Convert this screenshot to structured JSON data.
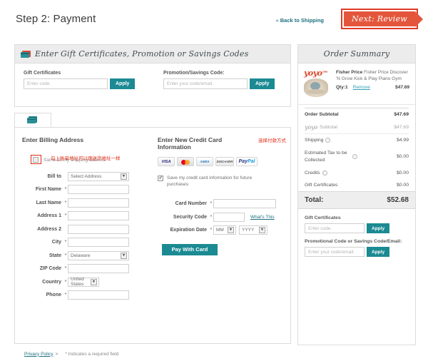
{
  "header": {
    "title": "Step 2: Payment",
    "back_link": "Back to Shipping",
    "back_chevron": "«",
    "next_button": "Next: Review",
    "accent_red": "#e4563c",
    "accent_teal": "#1b8a93"
  },
  "gift_panel": {
    "heading": "Enter Gift Certificates, Promotion or Savings Codes",
    "gift_label": "Gift Certificates",
    "gift_placeholder": "Enter code.",
    "gift_apply": "Apply",
    "promo_label": "Promotion/Savings Code:",
    "promo_placeholder": "Enter your code/email.",
    "promo_apply": "Apply"
  },
  "billing": {
    "heading": "Enter Billing Address",
    "same_as_shipping": "Same as my shipping address",
    "same_as_shipping_note_cn": "勾上账单地址可以跟送货地址一样",
    "fields": [
      {
        "label": "Bill to",
        "required": false,
        "type": "select",
        "value": "Select Address"
      },
      {
        "label": "First Name",
        "required": true,
        "type": "text",
        "value": ""
      },
      {
        "label": "Last Name",
        "required": true,
        "type": "text",
        "value": ""
      },
      {
        "label": "Address 1",
        "required": true,
        "type": "text",
        "value": ""
      },
      {
        "label": "Address 2",
        "required": false,
        "type": "text",
        "value": ""
      },
      {
        "label": "City",
        "required": true,
        "type": "text",
        "value": ""
      },
      {
        "label": "State",
        "required": true,
        "type": "select",
        "value": "Delaware"
      },
      {
        "label": "ZIP Code",
        "required": true,
        "type": "text",
        "value": ""
      },
      {
        "label": "Country",
        "required": true,
        "type": "select-narrow",
        "value": "United States"
      },
      {
        "label": "Phone",
        "required": true,
        "type": "text",
        "value": ""
      }
    ]
  },
  "credit_card": {
    "heading": "Enter New Credit Card Information",
    "heading_note_cn": "选择付款方式",
    "logos": [
      "VISA",
      "MasterCard",
      "AMERICAN EXPRESS",
      "DISCOVER",
      "PayPal"
    ],
    "save_card_label": "Save my credit card information for future purchases",
    "save_card_checked": true,
    "card_number_label": "Card Number",
    "card_number_value": "",
    "security_code_label": "Security Code",
    "security_code_value": "",
    "whats_this": "What's This",
    "expiration_label": "Expiration Date",
    "exp_month": "MM",
    "exp_year": "YYYY",
    "pay_button": "Pay With Card"
  },
  "footer": {
    "privacy_policy": "Privacy Policy",
    "privacy_chevron": ">",
    "required_note": "*  Indicates a required field"
  },
  "order_summary": {
    "heading": "Order Summary",
    "brand": "yoyo",
    "brand_sup": ".com",
    "item": {
      "brand": "Fisher Price",
      "name": "Fisher Price Discover 'N Grow Kick & Play Piano Gym",
      "qty_label": "Qty:1",
      "remove_label": "Remove",
      "price": "$47.69"
    },
    "totals": [
      {
        "label": "Order Subtotal",
        "value": "$47.69",
        "style": "bold",
        "info": false
      },
      {
        "label": "Subtotal",
        "value": "$47.69",
        "style": "muted",
        "info": false,
        "brand_prefix": true
      },
      {
        "label": "Shipping",
        "value": "$4.99",
        "style": "",
        "info": true
      },
      {
        "label": "Estimated Tax to be Collected",
        "value": "$0.00",
        "style": "",
        "info": true
      },
      {
        "label": "Credits",
        "value": "$0.00",
        "style": "",
        "info": true
      },
      {
        "label": "Gift Certificates",
        "value": "$0.00",
        "style": "",
        "info": false
      }
    ],
    "total_label": "Total:",
    "total_value": "$52.68",
    "gift_label": "Gift Certificates",
    "gift_placeholder": "Enter code.",
    "gift_apply": "Apply",
    "promo_label": "Promotional Code or Savings Code/Email:",
    "promo_placeholder": "Enter your code/email.",
    "promo_apply": "Apply"
  }
}
